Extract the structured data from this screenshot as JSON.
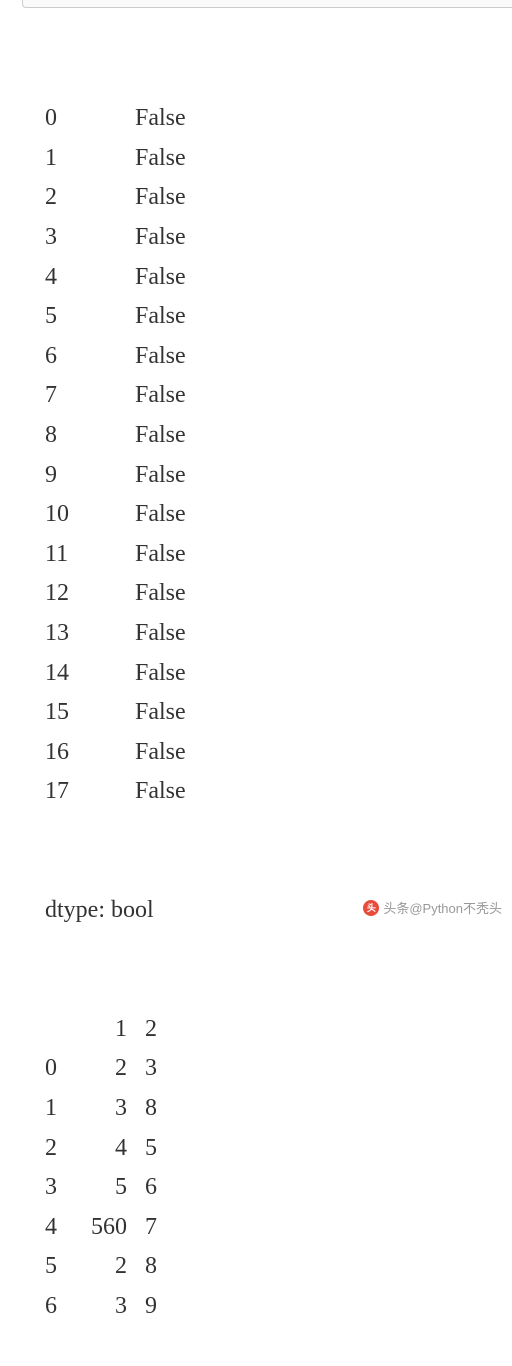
{
  "series": {
    "rows": [
      {
        "index": "0",
        "value": "False"
      },
      {
        "index": "1",
        "value": "False"
      },
      {
        "index": "2",
        "value": "False"
      },
      {
        "index": "3",
        "value": "False"
      },
      {
        "index": "4",
        "value": "False"
      },
      {
        "index": "5",
        "value": "False"
      },
      {
        "index": "6",
        "value": "False"
      },
      {
        "index": "7",
        "value": "False"
      },
      {
        "index": "8",
        "value": "False"
      },
      {
        "index": "9",
        "value": "False"
      },
      {
        "index": "10",
        "value": "False"
      },
      {
        "index": "11",
        "value": "False"
      },
      {
        "index": "12",
        "value": "False"
      },
      {
        "index": "13",
        "value": "False"
      },
      {
        "index": "14",
        "value": "False"
      },
      {
        "index": "15",
        "value": "False"
      },
      {
        "index": "16",
        "value": "False"
      },
      {
        "index": "17",
        "value": "False"
      }
    ],
    "dtype": "dtype: bool"
  },
  "dataframe": {
    "header": {
      "idx": "",
      "col1": "1",
      "col2": "2"
    },
    "rows": [
      {
        "idx": "0",
        "col1": "2",
        "col2": "3"
      },
      {
        "idx": "1",
        "col1": "3",
        "col2": "8"
      },
      {
        "idx": "2",
        "col1": "4",
        "col2": "5"
      },
      {
        "idx": "3",
        "col1": "5",
        "col2": "6"
      },
      {
        "idx": "4",
        "col1": "560",
        "col2": "7"
      },
      {
        "idx": "5",
        "col1": "2",
        "col2": "8"
      },
      {
        "idx": "6",
        "col1": "3",
        "col2": "9"
      }
    ]
  },
  "watermark": {
    "text": "头条@Python不秃头"
  }
}
